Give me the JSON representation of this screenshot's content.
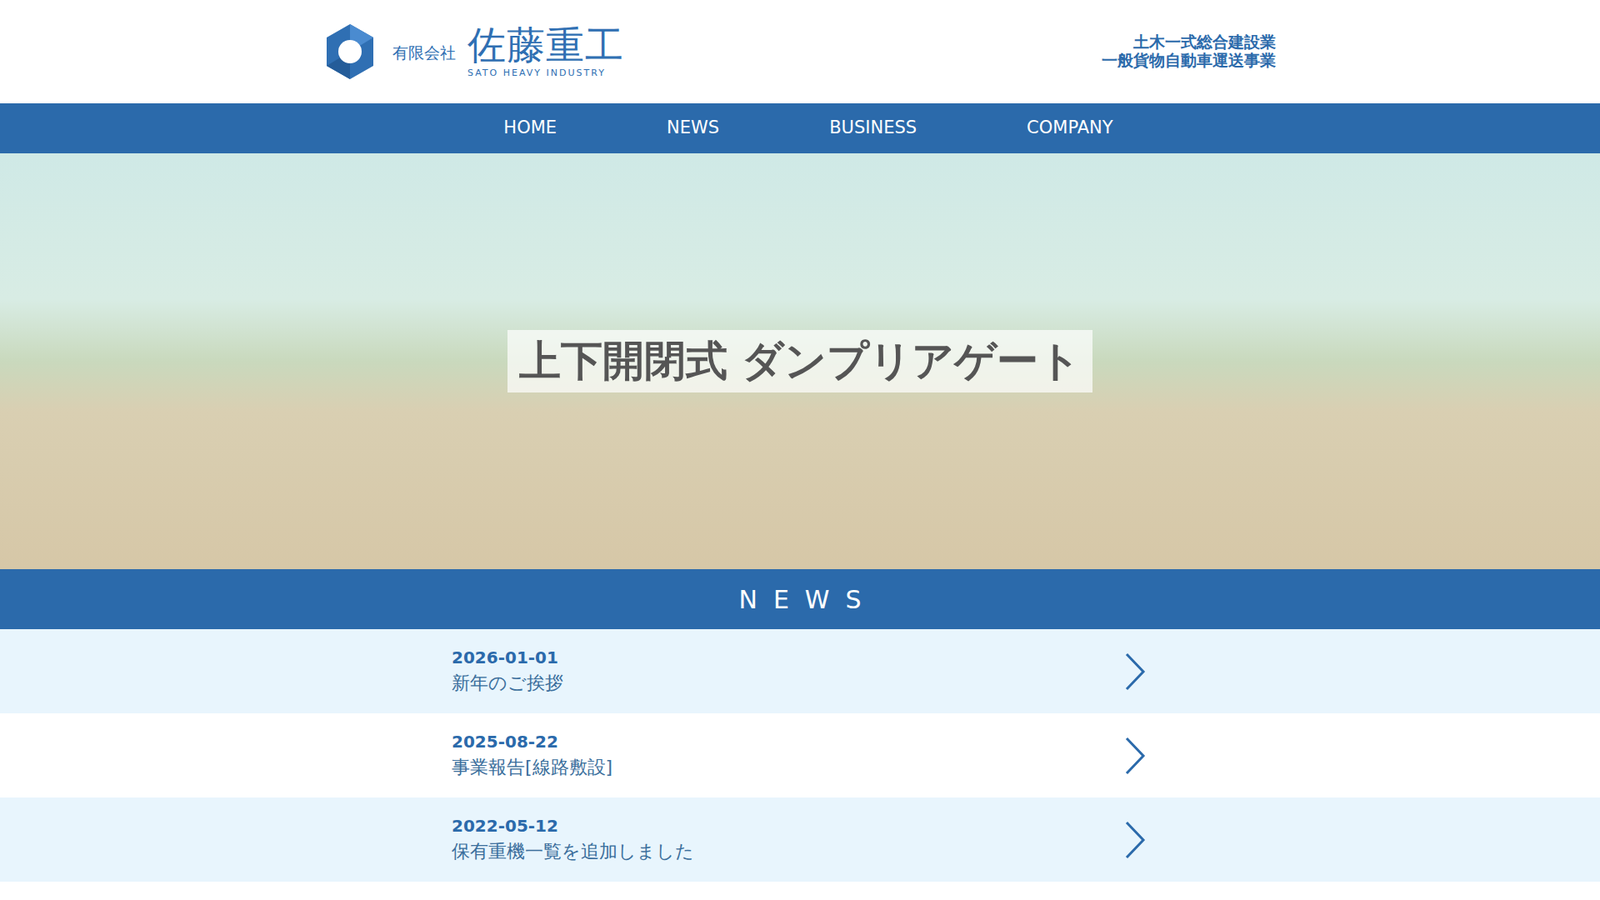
{
  "logo": {
    "prefix": "有限会社",
    "name": "佐藤重工",
    "subtitle": "SATO HEAVY INDUSTRY"
  },
  "tagline": [
    "土木一式総合建設業",
    "一般貨物自動車運送事業"
  ],
  "nav": [
    {
      "label": "HOME",
      "selected": false
    },
    {
      "label": "NEWS",
      "selected": false
    },
    {
      "label": "BUSINESS",
      "selected": false
    },
    {
      "label": "COMPANY",
      "selected": false
    }
  ],
  "hero": {
    "caption": "上下開閉式 ダンプリアゲート"
  },
  "news": {
    "heading": "NEWS",
    "items": [
      {
        "date": "2026-01-01",
        "title": "新年のご挨拶"
      },
      {
        "date": "2025-08-22",
        "title": "事業報告[線路敷設]"
      },
      {
        "date": "2022-05-12",
        "title": "保有重機一覧を追加しました"
      }
    ]
  }
}
